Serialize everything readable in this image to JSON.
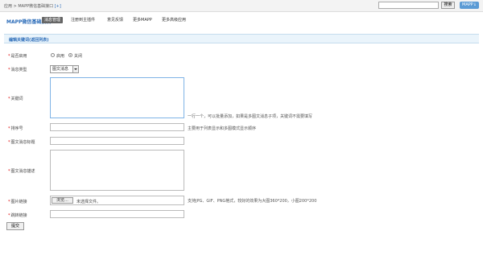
{
  "topbar": {
    "breadcrumb": "应用 > MAPP微信基础接口",
    "plus": "[+]",
    "search_value": "",
    "search_button": "搜索",
    "badge": "MAPP↓"
  },
  "subnav": {
    "brand": "MAPP微信基础接口",
    "tabs": [
      {
        "label": "消息管理",
        "active": true
      },
      {
        "label": "注册到主插件",
        "active": false
      },
      {
        "label": "意见反馈",
        "active": false
      },
      {
        "label": "更多MAPP",
        "active": false
      },
      {
        "label": "更多高级应用",
        "active": false
      }
    ]
  },
  "panel": {
    "title": "编辑关键词(返回列表)"
  },
  "form": {
    "enabled": {
      "label": "是否启用",
      "option_on": "启用",
      "option_off": "关闭",
      "selected": "关闭"
    },
    "msg_type": {
      "label": "消息类型",
      "value": "图文消息"
    },
    "keyword": {
      "label": "关键词",
      "value": "",
      "hint": "一行一个，可以批量添加，如果是多图文消息子项，关键词不需要填写"
    },
    "sort": {
      "label": "排序号",
      "value": "",
      "hint": "主要用于列表显示和多图模式显示顺序"
    },
    "title": {
      "label": "图文消息标题",
      "value": ""
    },
    "desc": {
      "label": "图文消息描述",
      "value": ""
    },
    "image": {
      "label": "图片链接",
      "browse": "浏览...",
      "file_status": "未选择文件。",
      "hint": "支持JPG、GIF、PNG格式，较好的效果为大图360*200，小图200*200"
    },
    "link": {
      "label": "跳转链接",
      "value": ""
    },
    "submit": "提交"
  }
}
